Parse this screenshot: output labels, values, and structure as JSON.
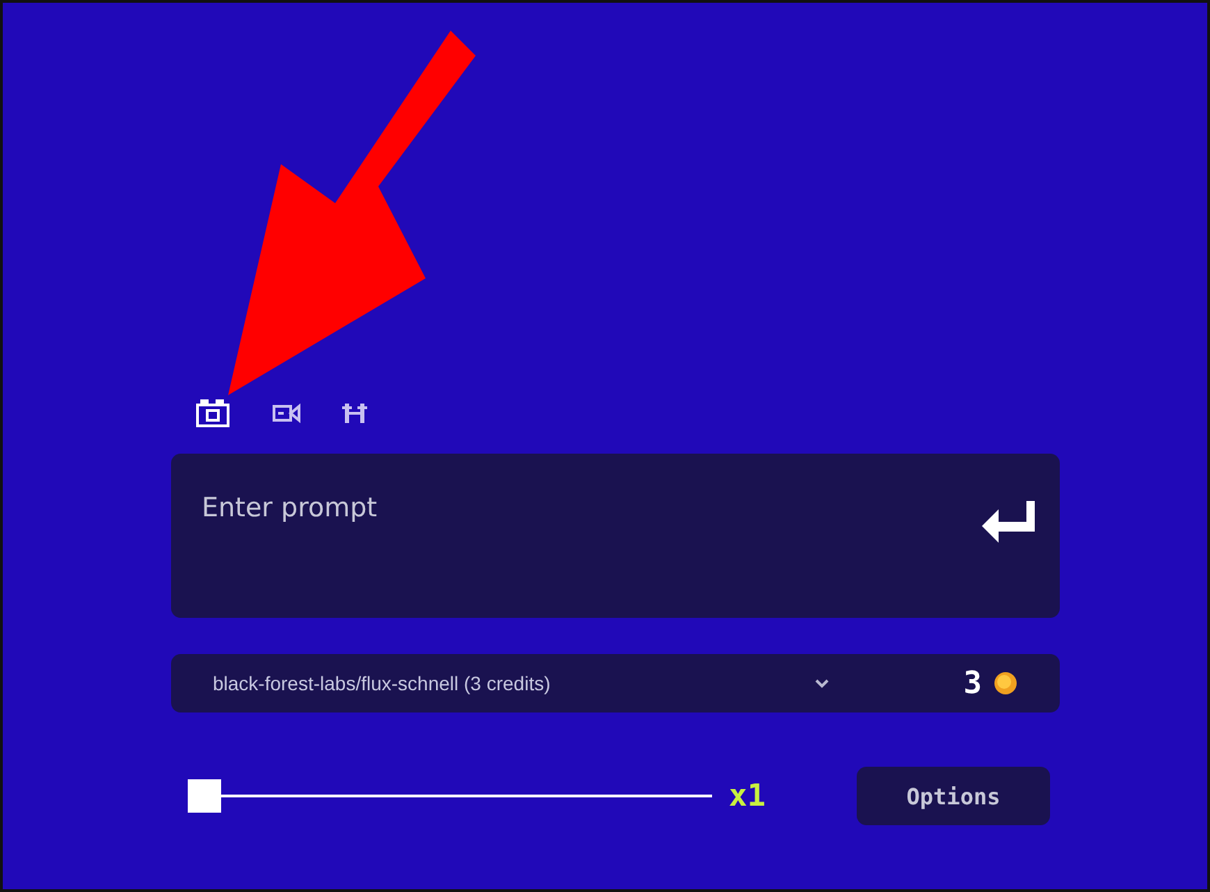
{
  "modes": [
    {
      "kind": "image",
      "selected": true
    },
    {
      "kind": "video",
      "selected": false
    },
    {
      "kind": "upscale",
      "selected": false
    }
  ],
  "prompt": {
    "placeholder": "Enter prompt"
  },
  "model": {
    "value": "black-forest-labs/flux-schnell (3 credits)",
    "credits": "3"
  },
  "count": {
    "level": 0,
    "reading": "x1"
  },
  "options_button": "Options",
  "annotation": {
    "kind": "arrow"
  }
}
